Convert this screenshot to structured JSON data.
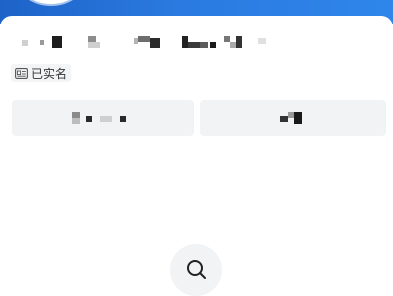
{
  "header": {
    "brand_color": "#2a7ae0"
  },
  "profile": {
    "verified_label": "已实名",
    "verified_icon": "id-card-icon"
  },
  "actions": {
    "left_button_icon": "redacted",
    "right_button_icon": "redacted"
  },
  "bottom": {
    "icon": "search-icon"
  }
}
